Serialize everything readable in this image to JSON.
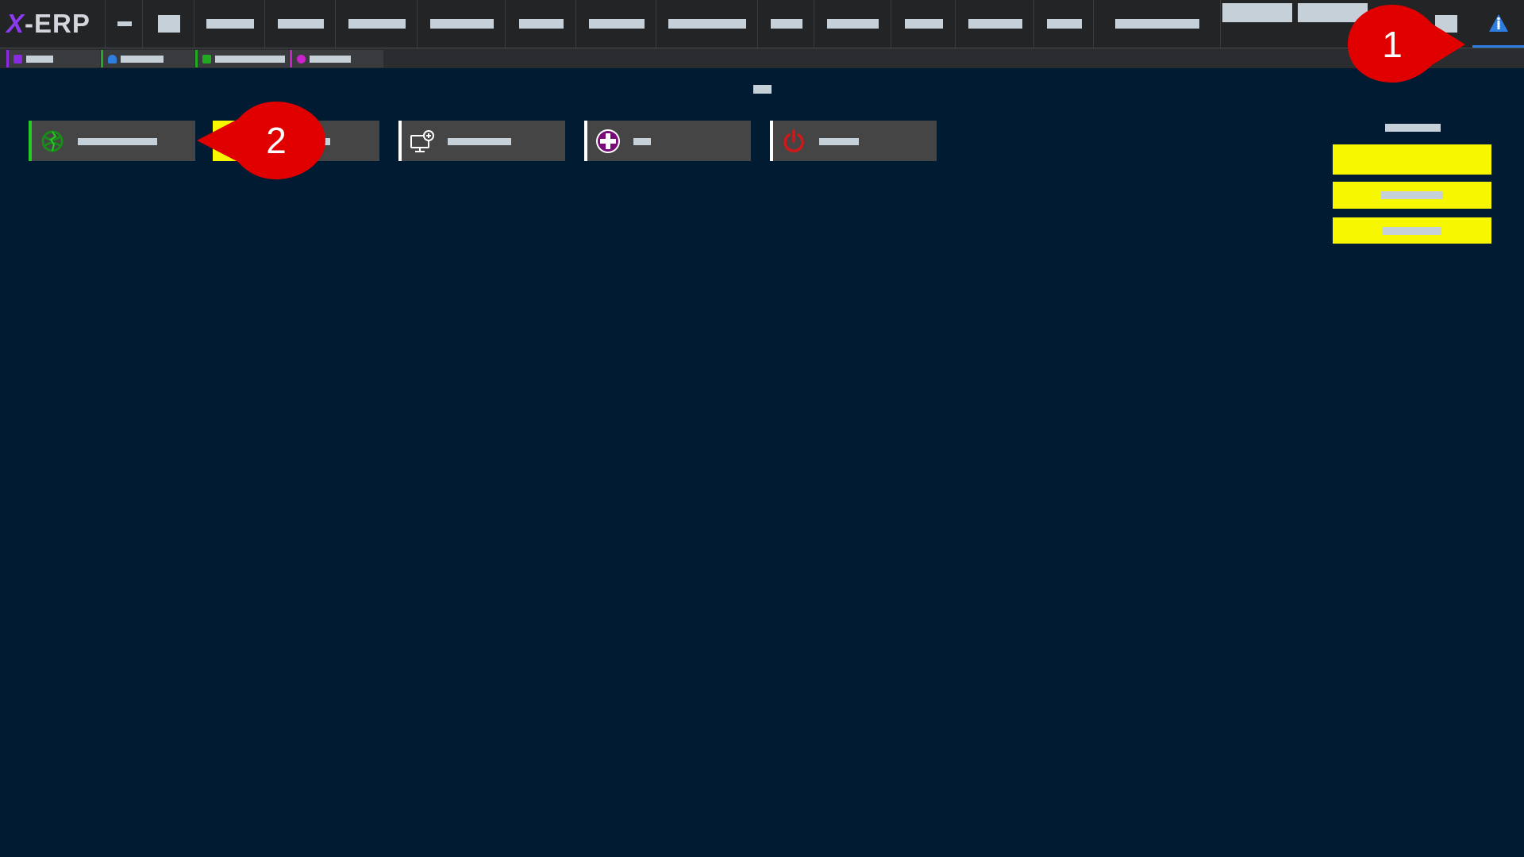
{
  "app": {
    "logo_x": "X",
    "logo_rest": "-ERP"
  },
  "menu": {
    "items": [
      {
        "id": "menu-item-1"
      },
      {
        "id": "menu-item-2"
      },
      {
        "id": "menu-item-3"
      },
      {
        "id": "menu-item-4"
      },
      {
        "id": "menu-item-5"
      },
      {
        "id": "menu-item-6"
      },
      {
        "id": "menu-item-7"
      },
      {
        "id": "menu-item-8"
      },
      {
        "id": "menu-item-9"
      },
      {
        "id": "menu-item-10"
      },
      {
        "id": "menu-item-11"
      },
      {
        "id": "menu-item-12"
      },
      {
        "id": "menu-item-13"
      },
      {
        "id": "menu-item-14"
      },
      {
        "id": "menu-item-15"
      }
    ],
    "info_icon": "info-icon"
  },
  "tabs": [
    {
      "icon_color": "#8a2be2"
    },
    {
      "icon_color": "#2e7de0"
    },
    {
      "icon_color": "#22aa22"
    },
    {
      "icon_color": "#cc22cc"
    }
  ],
  "quick_actions": [
    {
      "icon": "globe-icon",
      "accent": "#22cc22"
    },
    {
      "icon": "yellow-action-icon",
      "accent": "#f7f700"
    },
    {
      "icon": "monitor-add-icon",
      "accent": "#ffffff"
    },
    {
      "icon": "plus-circle-icon",
      "accent": "#ffffff"
    },
    {
      "icon": "power-icon",
      "accent": "#ffffff"
    }
  ],
  "side_panel": {
    "buttons": 3,
    "button_color": "#f7f700"
  },
  "callouts": [
    {
      "label": "1",
      "color": "#e00000"
    },
    {
      "label": "2",
      "color": "#e00000"
    }
  ],
  "colors": {
    "background": "#011c32",
    "menubar": "#222426",
    "placeholder_text": "#c6d0d9"
  }
}
